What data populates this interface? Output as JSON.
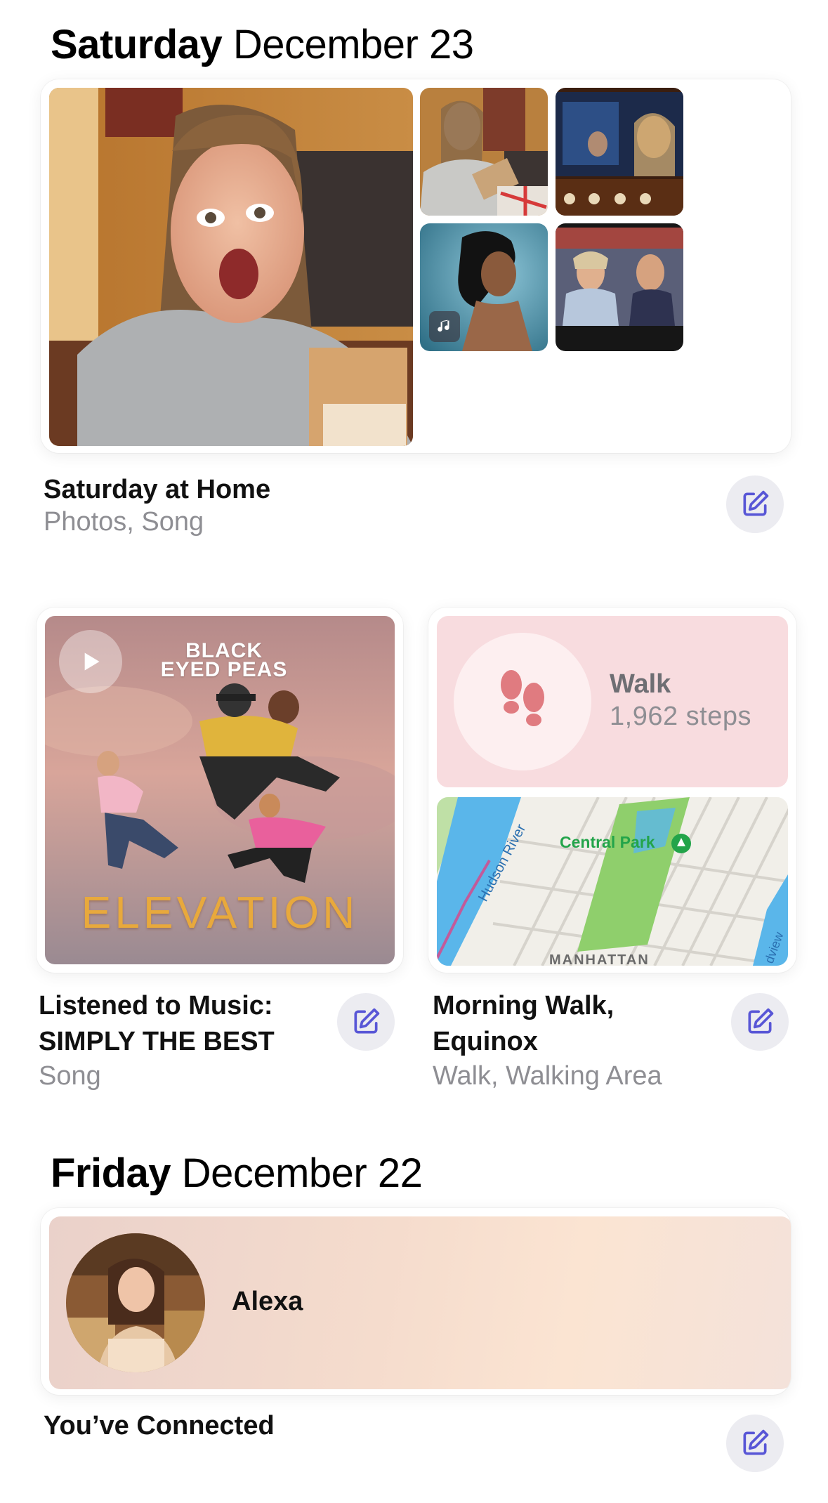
{
  "sections": [
    {
      "day": "Saturday",
      "date": "December 23"
    },
    {
      "day": "Friday",
      "date": "December 22"
    }
  ],
  "home_card": {
    "title": "Saturday at Home",
    "subtitle": "Photos, Song",
    "photo_icons": {
      "song_badge": "music-note-icon"
    }
  },
  "music_card": {
    "title_line1": "Listened to Music:",
    "title_line2": "SIMPLY THE BEST",
    "subtitle": "Song",
    "album_artist_art": "BLACK\nEYED PEAS",
    "album_title_art": "ELEVATION"
  },
  "walk_card": {
    "activity": "Walk",
    "steps": "1,962 steps",
    "title_line1": "Morning Walk,",
    "title_line2": "Equinox",
    "subtitle": "Walk, Walking Area",
    "map": {
      "park_label": "Central Park",
      "river_label": "Hudson River",
      "area_label": "MANHATTAN",
      "road_label": "dview"
    }
  },
  "connect_card": {
    "contact": "Alexa",
    "title": "You’ve Connected"
  },
  "colors": {
    "accent": "#5856d6",
    "edit_bg": "#ececf1",
    "walk_bg": "#f8dcdf",
    "footprint": "#e07b80"
  }
}
